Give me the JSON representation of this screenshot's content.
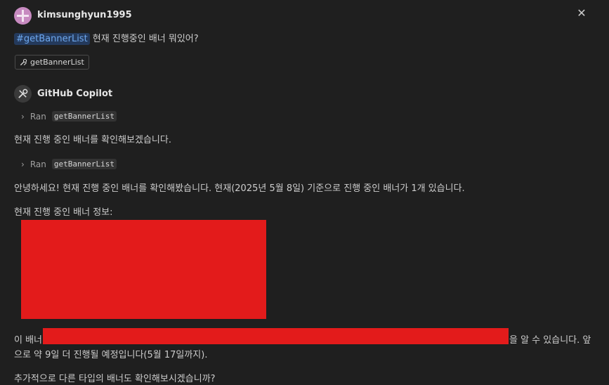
{
  "user": {
    "name": "kimsunghyun1995",
    "query_tag": "#getBannerList",
    "query_text": " 현재 진행중인 배너 뭐있어?",
    "attachment_label": "getBannerList"
  },
  "assistant": {
    "name": "GitHub Copilot",
    "ran_label": "Ran",
    "tool_name": "getBannerList",
    "msg1": "현재 진행 중인 배너를 확인해보겠습니다.",
    "msg2": "안녕하세요! 현재 진행 중인 배너를 확인해봤습니다. 현재(2025년 5월 8일) 기준으로 진행 중인 배너가 1개 있습니다.",
    "info_heading": "현재 진행 중인 배너 정보:",
    "line_prefix": "이 배너",
    "line_suffix": "을 알 수 있습니다. 앞",
    "line_continued": "으로 약 9일 더 진행될 예정입니다(5월 17일까지).",
    "closing": "추가적으로 다른 타입의 배너도 확인해보시겠습니까?"
  },
  "icons": {
    "close": "close-icon",
    "chevron": "chevron-right-icon",
    "tool": "tools-icon",
    "copilot": "copilot-icon"
  },
  "colors": {
    "background": "#1f1f1f",
    "tag_background": "#243a5c",
    "tag_text": "#6ea8ef",
    "redaction": "#e31b1b"
  }
}
